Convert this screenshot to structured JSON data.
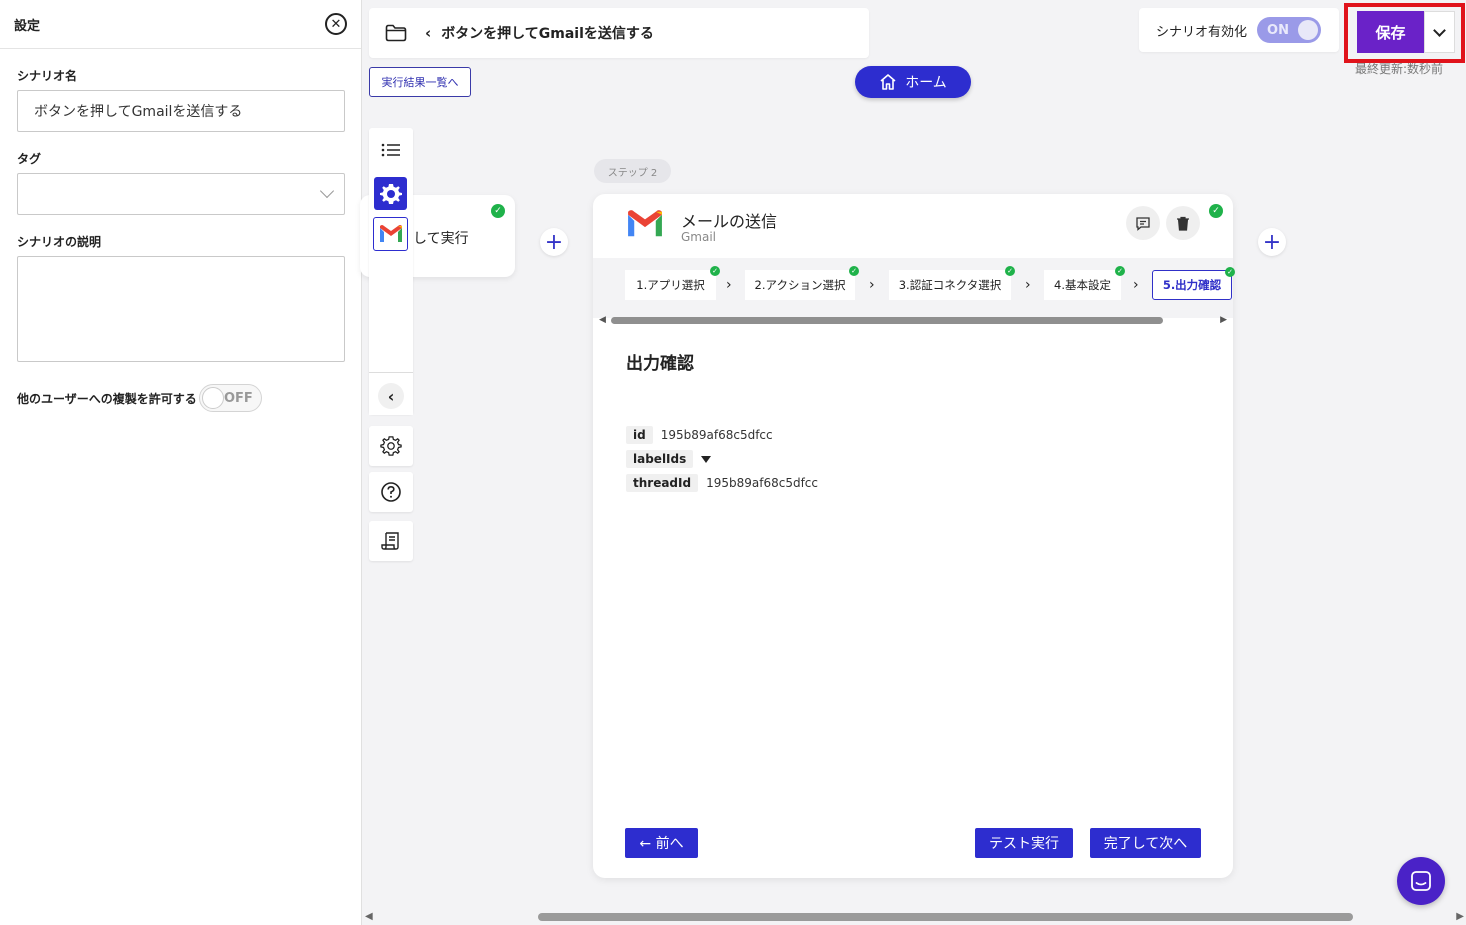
{
  "settings": {
    "title": "設定",
    "scenario_name_label": "シナリオ名",
    "scenario_name_value": "ボタンを押してGmailを送信する",
    "tag_label": "タグ",
    "description_label": "シナリオの説明",
    "copy_allow_label": "他のユーザーへの複製を許可する",
    "copy_allow_state": "OFF"
  },
  "header": {
    "breadcrumb_title": "ボタンを押してGmailを送信する",
    "results_link": "実行結果一覧へ",
    "home_label": "ホーム",
    "enable_label": "シナリオ有効化",
    "enable_state": "ON",
    "save_label": "保存",
    "last_updated": "最終更新:数秒前"
  },
  "canvas": {
    "step1_text": "して実行",
    "step_pill": "ステップ 2"
  },
  "card": {
    "title": "メールの送信",
    "subtitle": "Gmail",
    "tabs": [
      {
        "label": "1.アプリ選択"
      },
      {
        "label": "2.アクション選択"
      },
      {
        "label": "3.認証コネクタ選択"
      },
      {
        "label": "4.基本設定"
      },
      {
        "label": "5.出力確認"
      }
    ],
    "section_title": "出力確認",
    "outputs": [
      {
        "key": "id",
        "value": "195b89af68c5dfcc"
      },
      {
        "key": "labelIds",
        "value": ""
      },
      {
        "key": "threadId",
        "value": "195b89af68c5dfcc"
      }
    ],
    "prev_label": "← 前へ",
    "test_label": "テスト実行",
    "next_label": "完了して次へ"
  },
  "colors": {
    "accent": "#2d2dcf",
    "save": "#6a22c8",
    "highlight": "#e0131b",
    "success": "#1fb24a"
  }
}
